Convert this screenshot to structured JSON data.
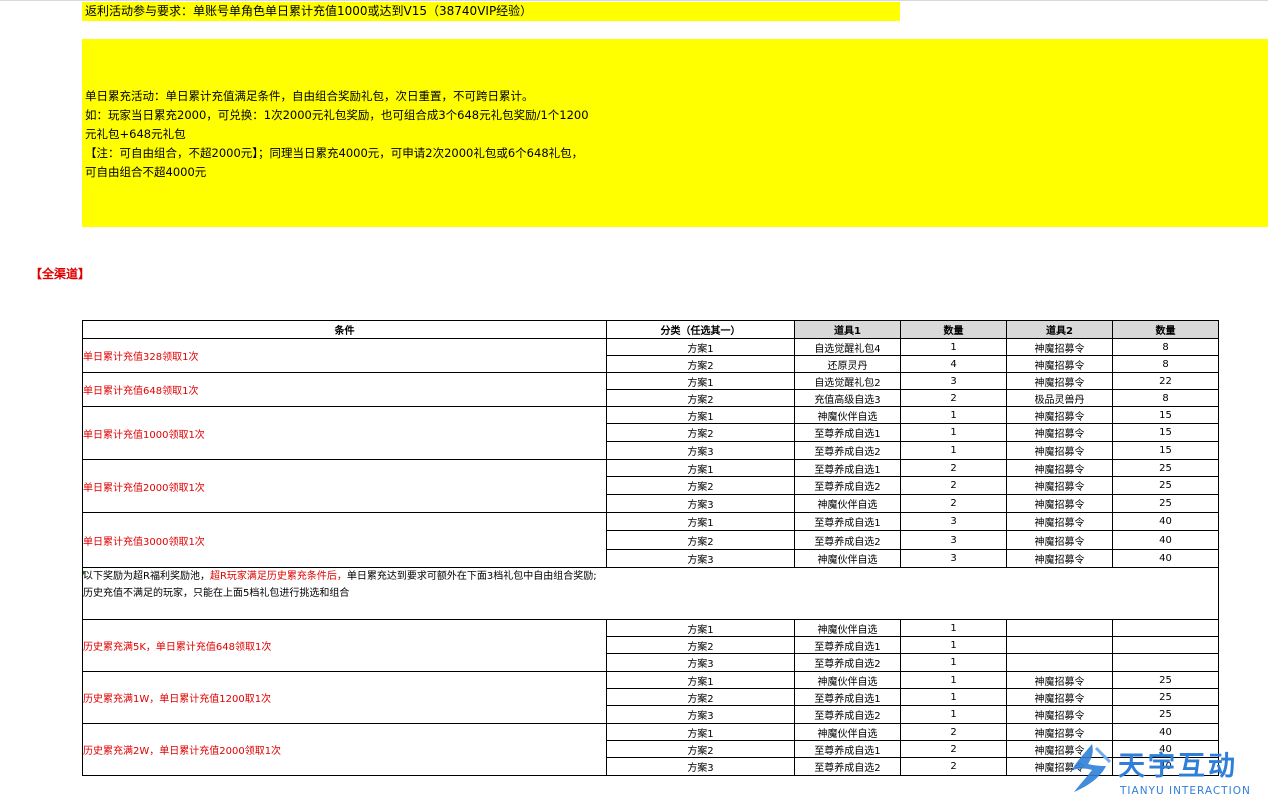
{
  "requirement": "返利活动参与要求：单账号单角色单日累计充值1000或达到V15（38740VIP经验）",
  "notes": [
    "单日累充活动：单日累计充值满足条件，自由组合奖励礼包，次日重置，不可跨日累计。",
    "如：玩家当日累充2000，可兑换：1次2000元礼包奖励，也可组合成3个648元礼包奖励/1个1200",
    "元礼包+648元礼包",
    "【注：可自由组合，不超2000元】；同理当日累充4000元，可申请2次2000礼包或6个648礼包，",
    "可自由组合不超4000元"
  ],
  "channel_label": "【全渠道】",
  "table": {
    "headers": [
      "条件",
      "分类（任选其一）",
      "道具1",
      "数量",
      "道具2",
      "数量"
    ],
    "groups_a": [
      {
        "condition": "单日累计充值328领取1次",
        "rows": [
          [
            "方案1",
            "自选觉醒礼包4",
            "1",
            "神魔招募令",
            "8"
          ],
          [
            "方案2",
            "还原灵丹",
            "4",
            "神魔招募令",
            "8"
          ]
        ]
      },
      {
        "condition": "单日累计充值648领取1次",
        "rows": [
          [
            "方案1",
            "自选觉醒礼包2",
            "3",
            "神魔招募令",
            "22"
          ],
          [
            "方案2",
            "充值高级自选3",
            "2",
            "极品灵兽丹",
            "8"
          ]
        ]
      },
      {
        "condition": "单日累计充值1000领取1次",
        "rows": [
          [
            "方案1",
            "神魔伙伴自选",
            "1",
            "神魔招募令",
            "15"
          ],
          [
            "方案2",
            "至尊养成自选1",
            "1",
            "神魔招募令",
            "15"
          ],
          [
            "方案3",
            "至尊养成自选2",
            "1",
            "神魔招募令",
            "15"
          ]
        ]
      },
      {
        "condition": "单日累计充值2000领取1次",
        "rows": [
          [
            "方案1",
            "至尊养成自选1",
            "2",
            "神魔招募令",
            "25"
          ],
          [
            "方案2",
            "至尊养成自选2",
            "2",
            "神魔招募令",
            "25"
          ],
          [
            "方案3",
            "神魔伙伴自选",
            "2",
            "神魔招募令",
            "25"
          ]
        ]
      },
      {
        "condition": "单日累计充值3000领取1次",
        "rows": [
          [
            "方案1",
            "至尊养成自选1",
            "3",
            "神魔招募令",
            "40"
          ],
          [
            "方案2",
            "至尊养成自选2",
            "3",
            "神魔招募令",
            "40"
          ],
          [
            "方案3",
            "神魔伙伴自选",
            "3",
            "神魔招募令",
            "40"
          ]
        ]
      }
    ],
    "note_line1_a": "以下奖励为超R福利奖励池，",
    "note_line1_red": "超R玩家满足历史累充条件后，",
    "note_line1_b": "单日累充达到要求可额外在下面3档礼包中自由组合奖励;",
    "note_line2": "历史充值不满足的玩家，只能在上面5档礼包进行挑选和组合",
    "groups_b": [
      {
        "condition": "历史累充满5K，单日累计充值648领取1次",
        "rows": [
          [
            "方案1",
            "神魔伙伴自选",
            "1",
            "",
            ""
          ],
          [
            "方案2",
            "至尊养成自选1",
            "1",
            "",
            ""
          ],
          [
            "方案3",
            "至尊养成自选2",
            "1",
            "",
            ""
          ]
        ]
      },
      {
        "condition": "历史累充满1W，单日累计充值1200取1次",
        "rows": [
          [
            "方案1",
            "神魔伙伴自选",
            "1",
            "神魔招募令",
            "25"
          ],
          [
            "方案2",
            "至尊养成自选1",
            "1",
            "神魔招募令",
            "25"
          ],
          [
            "方案3",
            "至尊养成自选2",
            "1",
            "神魔招募令",
            "25"
          ]
        ]
      },
      {
        "condition": "历史累充满2W，单日累计充值2000领取1次",
        "rows": [
          [
            "方案1",
            "神魔伙伴自选",
            "2",
            "神魔招募令",
            "40"
          ],
          [
            "方案2",
            "至尊养成自选1",
            "2",
            "神魔招募令",
            "40"
          ],
          [
            "方案3",
            "至尊养成自选2",
            "2",
            "神魔招募令",
            "40"
          ]
        ]
      }
    ]
  },
  "watermark": {
    "name_cn": "天宇互动",
    "name_en": "TIANYU INTERACTION",
    "icon": "tianyu-logo-icon",
    "color": "#2f7fd8"
  }
}
